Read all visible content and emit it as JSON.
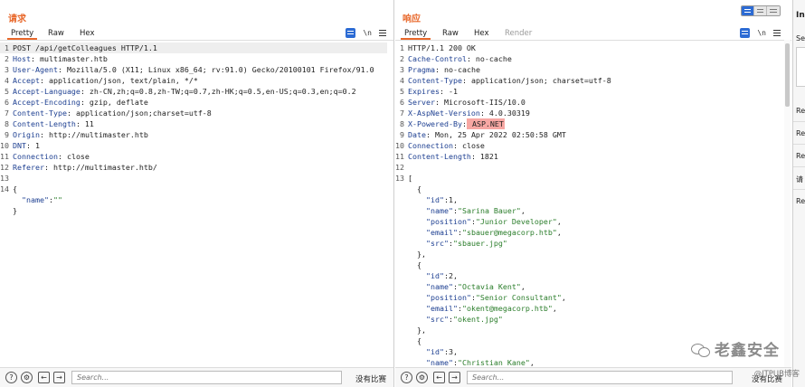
{
  "request": {
    "title": "请求",
    "tabs": [
      "Pretty",
      "Raw",
      "Hex"
    ],
    "lines": [
      {
        "n": "1",
        "text": "POST /api/getColleagues HTTP/1.1"
      },
      {
        "n": "2",
        "key": "Host",
        "value": " multimaster.htb"
      },
      {
        "n": "3",
        "key": "User-Agent",
        "value": " Mozilla/5.0 (X11; Linux x86_64; rv:91.0) Gecko/20100101 Firefox/91.0"
      },
      {
        "n": "4",
        "key": "Accept",
        "value": " application/json, text/plain, */*"
      },
      {
        "n": "5",
        "key": "Accept-Language",
        "value": " zh-CN,zh;q=0.8,zh-TW;q=0.7,zh-HK;q=0.5,en-US;q=0.3,en;q=0.2"
      },
      {
        "n": "6",
        "key": "Accept-Encoding",
        "value": " gzip, deflate"
      },
      {
        "n": "7",
        "key": "Content-Type",
        "value": " application/json;charset=utf-8"
      },
      {
        "n": "8",
        "key": "Content-Length",
        "value": " 11"
      },
      {
        "n": "9",
        "key": "Origin",
        "value": " http://multimaster.htb"
      },
      {
        "n": "10",
        "key": "DNT",
        "value": " 1"
      },
      {
        "n": "11",
        "key": "Connection",
        "value": " close"
      },
      {
        "n": "12",
        "key": "Referer",
        "value": " http://multimaster.htb/"
      },
      {
        "n": "13",
        "text": ""
      },
      {
        "n": "14",
        "text": "{"
      },
      {
        "n": "",
        "indent": "  ",
        "jkey": "\"name\"",
        "colon": ":",
        "jval": "\"\""
      },
      {
        "n": "",
        "text": "}"
      }
    ],
    "search_placeholder": "Search...",
    "match_text": "没有比赛"
  },
  "response": {
    "title": "响应",
    "tabs": [
      "Pretty",
      "Raw",
      "Hex",
      "Render"
    ],
    "lines": [
      {
        "n": "1",
        "text": "HTTP/1.1 200 OK"
      },
      {
        "n": "2",
        "key": "Cache-Control",
        "value": " no-cache"
      },
      {
        "n": "3",
        "key": "Pragma",
        "value": " no-cache"
      },
      {
        "n": "4",
        "key": "Content-Type",
        "value": " application/json; charset=utf-8"
      },
      {
        "n": "5",
        "key": "Expires",
        "value": " -1"
      },
      {
        "n": "6",
        "key": "Server",
        "value": " Microsoft-IIS/10.0"
      },
      {
        "n": "7",
        "key": "X-AspNet-Version",
        "value": " 4.0.30319"
      },
      {
        "n": "8",
        "key": "X-Powered-By",
        "value": " ASP.NET",
        "highlight": true
      },
      {
        "n": "9",
        "key": "Date",
        "value": " Mon, 25 Apr 2022 02:50:58 GMT"
      },
      {
        "n": "10",
        "key": "Connection",
        "value": " close"
      },
      {
        "n": "11",
        "key": "Content-Length",
        "value": " 1821"
      },
      {
        "n": "12",
        "text": ""
      },
      {
        "n": "13",
        "text": "["
      },
      {
        "n": "",
        "text": "  {"
      },
      {
        "n": "",
        "indent": "    ",
        "jkey": "\"id\"",
        "colon": ":",
        "jnum": "1",
        "tail": ","
      },
      {
        "n": "",
        "indent": "    ",
        "jkey": "\"name\"",
        "colon": ":",
        "jval": "\"Sarina Bauer\"",
        "tail": ","
      },
      {
        "n": "",
        "indent": "    ",
        "jkey": "\"position\"",
        "colon": ":",
        "jval": "\"Junior Developer\"",
        "tail": ","
      },
      {
        "n": "",
        "indent": "    ",
        "jkey": "\"email\"",
        "colon": ":",
        "jval": "\"sbauer@megacorp.htb\"",
        "tail": ","
      },
      {
        "n": "",
        "indent": "    ",
        "jkey": "\"src\"",
        "colon": ":",
        "jval": "\"sbauer.jpg\""
      },
      {
        "n": "",
        "text": "  },"
      },
      {
        "n": "",
        "text": "  {"
      },
      {
        "n": "",
        "indent": "    ",
        "jkey": "\"id\"",
        "colon": ":",
        "jnum": "2",
        "tail": ","
      },
      {
        "n": "",
        "indent": "    ",
        "jkey": "\"name\"",
        "colon": ":",
        "jval": "\"Octavia Kent\"",
        "tail": ","
      },
      {
        "n": "",
        "indent": "    ",
        "jkey": "\"position\"",
        "colon": ":",
        "jval": "\"Senior Consultant\"",
        "tail": ","
      },
      {
        "n": "",
        "indent": "    ",
        "jkey": "\"email\"",
        "colon": ":",
        "jval": "\"okent@megacorp.htb\"",
        "tail": ","
      },
      {
        "n": "",
        "indent": "    ",
        "jkey": "\"src\"",
        "colon": ":",
        "jval": "\"okent.jpg\""
      },
      {
        "n": "",
        "text": "  },"
      },
      {
        "n": "",
        "text": "  {"
      },
      {
        "n": "",
        "indent": "    ",
        "jkey": "\"id\"",
        "colon": ":",
        "jnum": "3",
        "tail": ","
      },
      {
        "n": "",
        "indent": "    ",
        "jkey": "\"name\"",
        "colon": ":",
        "jval": "\"Christian Kane\"",
        "tail": ","
      }
    ],
    "search_placeholder": "Search...",
    "match_text": "没有比赛"
  },
  "inspector": {
    "title": "Ins",
    "items": [
      "Se",
      "Re",
      "Re",
      "Re",
      "请",
      "Re"
    ]
  },
  "watermark": {
    "text": "老鑫安全",
    "credit": "@ITPUB博客"
  },
  "icons": {
    "help": "help-icon",
    "settings": "gear-icon",
    "back": "arrow-left-icon",
    "forward": "arrow-right-icon"
  },
  "colors": {
    "accent": "#e8682b",
    "header_key": "#1d3f91",
    "json_string": "#2a7d2a",
    "highlight": "#f7a7a3"
  }
}
